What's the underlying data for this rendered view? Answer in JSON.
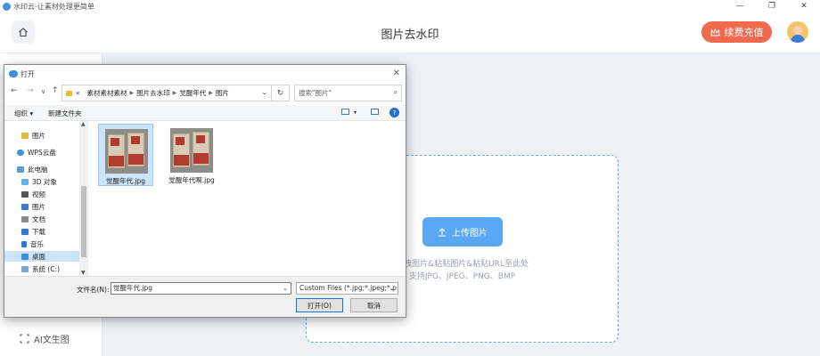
{
  "app": {
    "title": "水印云-让素材处理更简单",
    "page_title": "图片去水印",
    "recharge_label": "续费充值",
    "win_controls": [
      "—",
      "❐",
      "✕"
    ],
    "sidebar_item": "AI文生图",
    "upload_button": "上传图片",
    "upload_hint_1": "拖拽图片&粘贴图片&粘贴URL至此处",
    "upload_hint_2": "支持JPG、JPEG、PNG、BMP"
  },
  "dialog": {
    "title": "打开",
    "breadcrumb": [
      "«",
      "素材素材素材",
      "图片去水印",
      "觉醒年代",
      "图片"
    ],
    "search_placeholder": "搜索\"图片\"",
    "organize_label": "组织 ▾",
    "new_folder_label": "新建文件夹",
    "tree": [
      {
        "label": "图片",
        "icon": "folder-icon",
        "selected": false
      },
      {
        "label": "WPS云盘",
        "icon": "cloud-icon",
        "selected": false
      },
      {
        "label": "此电脑",
        "icon": "computer-icon",
        "selected": false
      },
      {
        "label": "3D 对象",
        "icon": "cube-icon",
        "selected": false
      },
      {
        "label": "视频",
        "icon": "video-icon",
        "selected": false
      },
      {
        "label": "图片",
        "icon": "picture-icon",
        "selected": false
      },
      {
        "label": "文档",
        "icon": "document-icon",
        "selected": false
      },
      {
        "label": "下载",
        "icon": "download-icon",
        "selected": false
      },
      {
        "label": "音乐",
        "icon": "music-icon",
        "selected": false
      },
      {
        "label": "桌面",
        "icon": "desktop-icon",
        "selected": true
      },
      {
        "label": "系统 (C:)",
        "icon": "drive-icon",
        "selected": false
      }
    ],
    "files": [
      {
        "name": "觉醒年代.jpg",
        "selected": true
      },
      {
        "name": "觉醒年代啊.jpg",
        "selected": false
      }
    ],
    "filename_label": "文件名(N):",
    "filename_value": "觉醒年代.jpg",
    "filetype_value": "Custom Files (*.jpg;*.jpeg;*.p",
    "open_label": "打开(O)",
    "cancel_label": "取消"
  },
  "colors": {
    "accent": "#5aa8f5",
    "recharge": "#f26a4e",
    "selection": "#cce4f7"
  }
}
